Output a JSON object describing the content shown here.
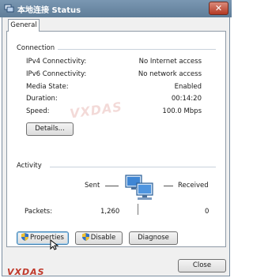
{
  "window": {
    "title": "本地连接 Status",
    "close_glyph": "✕"
  },
  "tabs": [
    {
      "label": "General"
    }
  ],
  "connection": {
    "heading": "Connection",
    "rows": [
      {
        "label": "IPv4 Connectivity:",
        "value": "No Internet access"
      },
      {
        "label": "IPv6 Connectivity:",
        "value": "No network access"
      },
      {
        "label": "Media State:",
        "value": "Enabled"
      },
      {
        "label": "Duration:",
        "value": "00:14:20"
      },
      {
        "label": "Speed:",
        "value": "100.0 Mbps"
      }
    ],
    "details_label": "Details..."
  },
  "activity": {
    "heading": "Activity",
    "sent_label": "Sent",
    "received_label": "Received",
    "packets_label": "Packets:",
    "packets_sent": "1,260",
    "packets_received": "0"
  },
  "buttons": {
    "properties": "Properties",
    "disable": "Disable",
    "diagnose": "Diagnose",
    "close": "Close"
  },
  "watermark": "VXDAS",
  "colors": {
    "titlebar": "#6b88a3",
    "panel": "#ffffff",
    "chrome": "#f0f0f0",
    "shield_blue": "#2f6fc4",
    "shield_yellow": "#f2c230"
  }
}
